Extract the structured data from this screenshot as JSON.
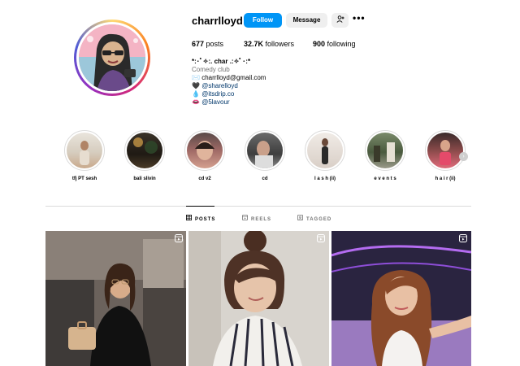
{
  "profile": {
    "username": "charrlloyd",
    "follow_label": "Follow",
    "message_label": "Message",
    "add_user_icon": "add-user-icon",
    "more_label": "•••"
  },
  "stats": {
    "posts_count": "677",
    "posts_label": " posts",
    "followers_count": "32.7K",
    "followers_label": " followers",
    "following_count": "900",
    "following_label": " following"
  },
  "bio": {
    "name": "*:･ﾟ✧:. char .:✧ﾟ･:*",
    "category": "Comedy club",
    "email_icon": "✉️",
    "email": "charrlloyd@gmail.com",
    "line2_icon": "🖤",
    "line2": "@sharelloyd",
    "line3_icon": "💧",
    "line3": "@itsdrip.co",
    "line4_icon": "👄",
    "line4": "@5lavour"
  },
  "highlights": [
    {
      "label": "tfj PT sesh"
    },
    {
      "label": "bali slivin"
    },
    {
      "label": "cd v2"
    },
    {
      "label": "cd"
    },
    {
      "label": "l a s h (ii)"
    },
    {
      "label": "e v e n t s"
    },
    {
      "label": "h a i r (ii)"
    }
  ],
  "tabs": [
    {
      "label": "POSTS",
      "icon": "grid-icon",
      "active": true
    },
    {
      "label": "REELS",
      "icon": "reels-icon",
      "active": false
    },
    {
      "label": "TAGGED",
      "icon": "tagged-icon",
      "active": false
    }
  ],
  "colors": {
    "accent": "#0095f6",
    "secondary_button": "#efefef",
    "link": "#00376b",
    "muted": "#737373"
  }
}
